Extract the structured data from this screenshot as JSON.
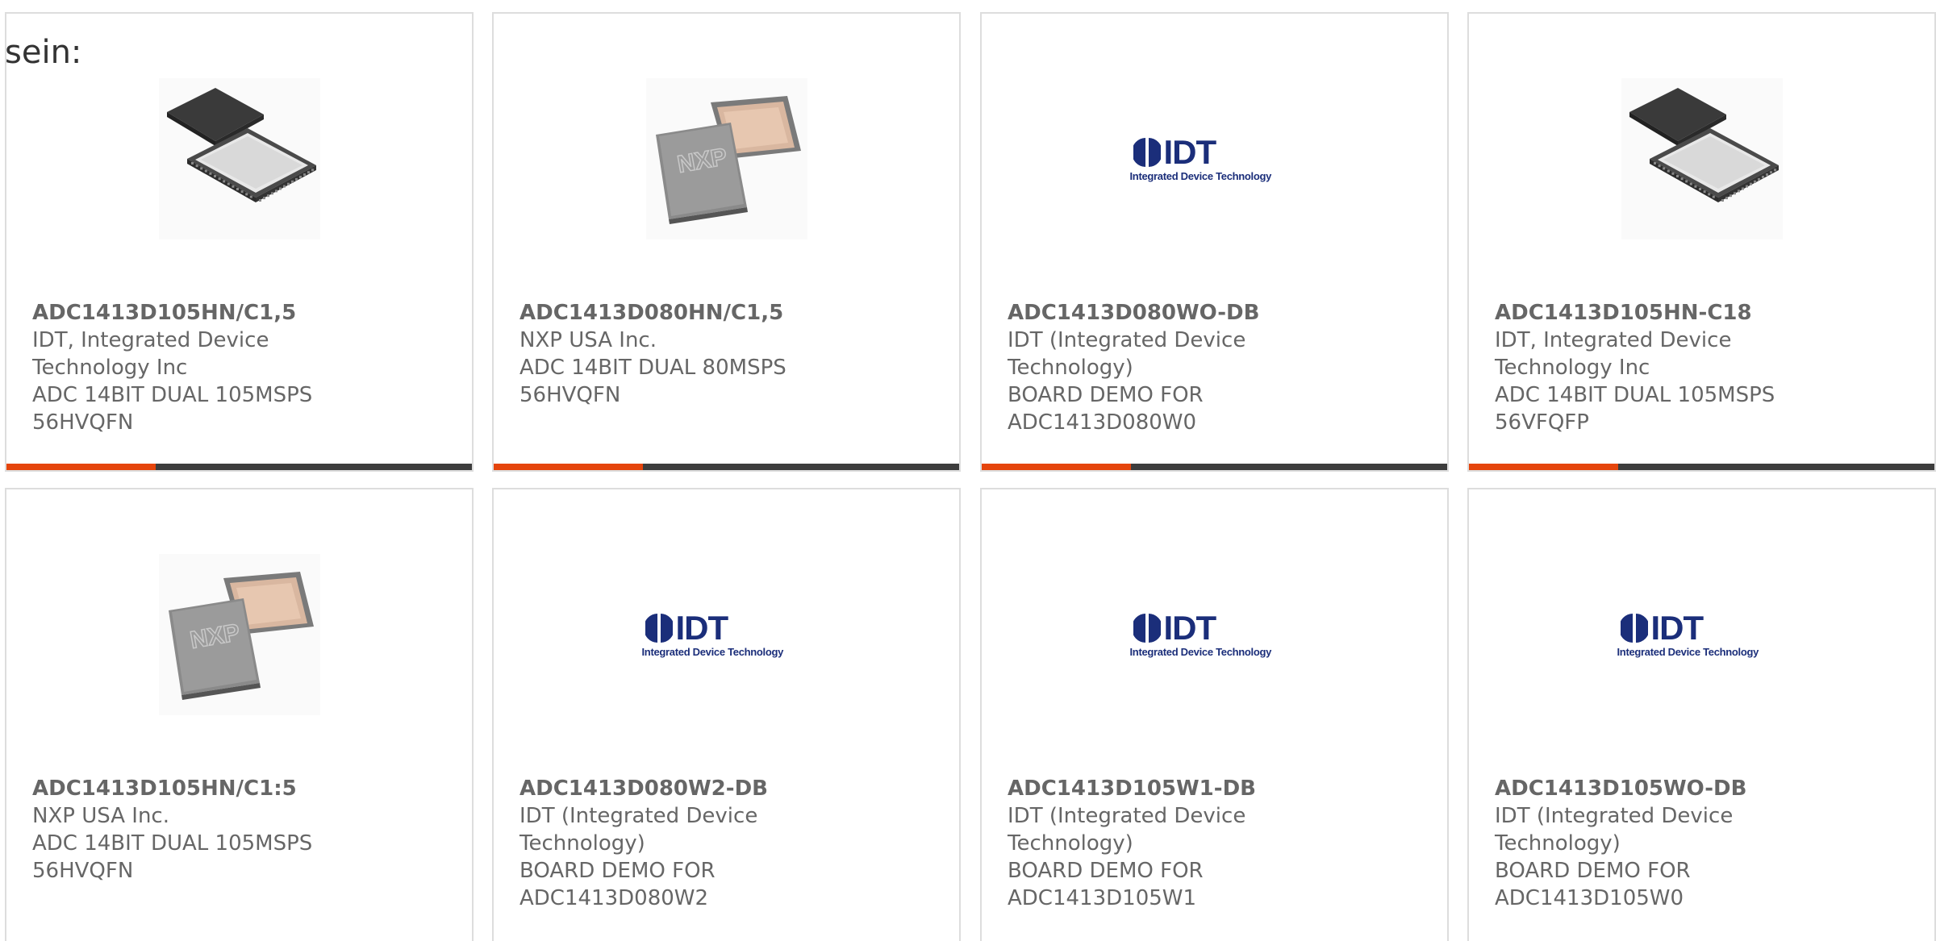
{
  "intro_text": "sein:",
  "colors": {
    "accent": "#e5450c",
    "bar": "#3d3d3d",
    "text": "#666666",
    "idt_blue": "#1b2e7a"
  },
  "products": [
    {
      "part": "ADC1413D105HN/C1,5",
      "lines": [
        "IDT, Integrated Device",
        "Technology Inc",
        "ADC 14BIT DUAL 105MSPS",
        "56HVQFN"
      ],
      "image": "qfn-chip-icon"
    },
    {
      "part": "ADC1413D080HN/C1,5",
      "lines": [
        "NXP USA Inc.",
        "ADC 14BIT DUAL 80MSPS",
        "56HVQFN"
      ],
      "image": "nxp-chip-icon"
    },
    {
      "part": "ADC1413D080WO-DB",
      "lines": [
        "IDT (Integrated Device",
        "Technology)",
        "BOARD DEMO FOR",
        "ADC1413D080W0"
      ],
      "image": "idt-logo"
    },
    {
      "part": "ADC1413D105HN-C18",
      "lines": [
        "IDT, Integrated Device",
        "Technology Inc",
        "ADC 14BIT DUAL 105MSPS",
        "56VFQFP"
      ],
      "image": "qfn-chip-icon"
    },
    {
      "part": "ADC1413D105HN/C1:5",
      "lines": [
        "NXP USA Inc.",
        "ADC 14BIT DUAL 105MSPS",
        "56HVQFN"
      ],
      "image": "nxp-chip-icon"
    },
    {
      "part": "ADC1413D080W2-DB",
      "lines": [
        "IDT (Integrated Device",
        "Technology)",
        "BOARD DEMO FOR",
        "ADC1413D080W2"
      ],
      "image": "idt-logo"
    },
    {
      "part": "ADC1413D105W1-DB",
      "lines": [
        "IDT (Integrated Device",
        "Technology)",
        "BOARD DEMO FOR",
        "ADC1413D105W1"
      ],
      "image": "idt-logo"
    },
    {
      "part": "ADC1413D105WO-DB",
      "lines": [
        "IDT (Integrated Device",
        "Technology)",
        "BOARD DEMO FOR",
        "ADC1413D105W0"
      ],
      "image": "idt-logo"
    }
  ],
  "logo": {
    "idt_word": "IDT",
    "idt_tagline": "Integrated Device Technology",
    "nxp_word": "NXP"
  }
}
